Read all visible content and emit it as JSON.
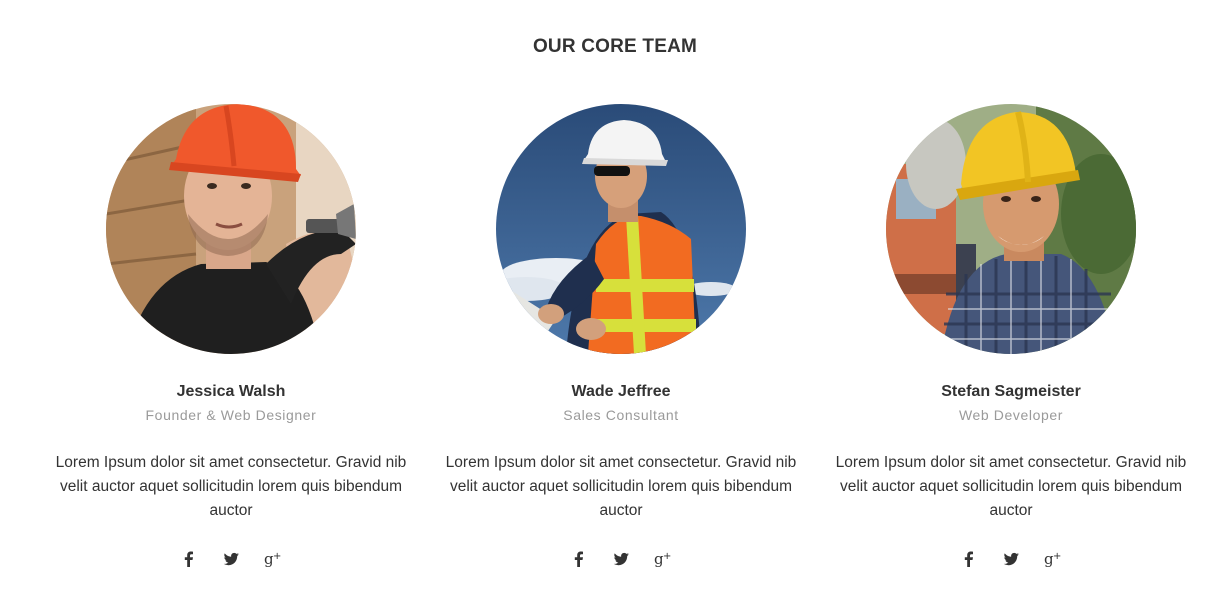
{
  "section": {
    "title": "OUR CORE TEAM"
  },
  "members": [
    {
      "name": "Jessica Walsh",
      "role": "Founder & Web Designer",
      "bio": "Lorem Ipsum dolor sit amet consectetur. Gravid nib velit auctor aquet sollicitudin lorem quis bibendum auctor",
      "photo": "construction-worker-orange-helmet",
      "social": [
        "facebook-icon",
        "twitter-icon",
        "google-plus-icon"
      ]
    },
    {
      "name": "Wade Jeffree",
      "role": "Sales Consultant",
      "bio": "Lorem Ipsum dolor sit amet consectetur. Gravid nib velit auctor aquet sollicitudin lorem quis bibendum auctor",
      "photo": "construction-worker-white-helmet-vest",
      "social": [
        "facebook-icon",
        "twitter-icon",
        "google-plus-icon"
      ]
    },
    {
      "name": "Stefan Sagmeister",
      "role": "Web Developer",
      "bio": "Lorem Ipsum dolor sit amet consectetur. Gravid nib velit auctor aquet sollicitudin lorem quis bibendum auctor",
      "photo": "construction-worker-yellow-helmet",
      "social": [
        "facebook-icon",
        "twitter-icon",
        "google-plus-icon"
      ]
    }
  ],
  "colors": {
    "heading": "#333333",
    "role": "#9a9a9a",
    "icon": "#333333"
  }
}
